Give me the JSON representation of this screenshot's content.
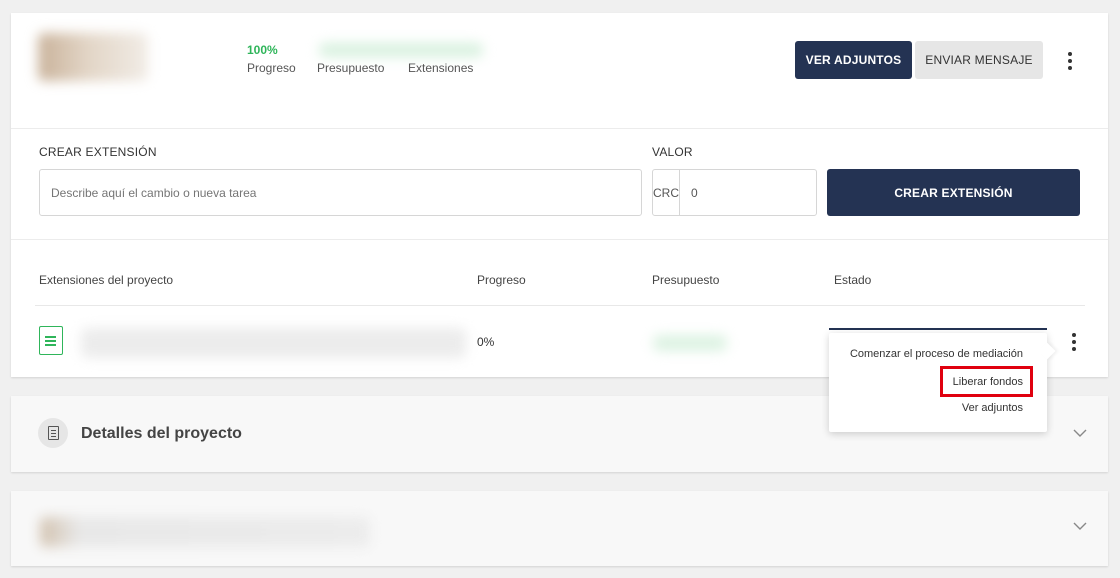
{
  "header": {
    "progress_value": "100%",
    "progress_label": "Progreso",
    "budget_label": "Presupuesto",
    "extensions_label": "Extensiones",
    "btn_adjuntos": "VER ADJUNTOS",
    "btn_mensaje": "ENVIAR MENSAJE"
  },
  "create": {
    "extension_label": "CREAR EXTENSIÓN",
    "value_label": "VALOR",
    "desc_placeholder": "Describe aquí el cambio o nueva tarea",
    "currency": "CRC",
    "value": "0",
    "button": "CREAR EXTENSIÓN"
  },
  "table": {
    "columns": [
      "Extensiones del proyecto",
      "Progreso",
      "Presupuesto",
      "Estado"
    ],
    "rows": [
      {
        "progress": "0%"
      }
    ]
  },
  "menu": {
    "items": [
      "Comenzar el proceso de mediación",
      "Liberar fondos",
      "Ver adjuntos"
    ]
  },
  "details": {
    "title": "Detalles del proyecto"
  },
  "colors": {
    "accent_dark": "#243353",
    "success": "#2fb55a",
    "highlight": "#e0000f"
  },
  "icons": {
    "file": "document-icon",
    "details": "sheet-icon",
    "more": "kebab-icon",
    "expand": "chevron-down-icon"
  }
}
